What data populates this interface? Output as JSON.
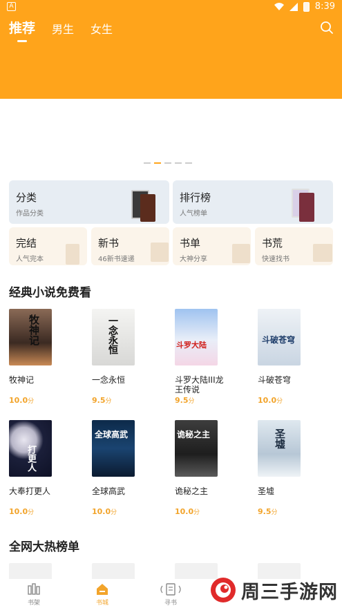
{
  "status": {
    "time": "8:39",
    "battery": "8"
  },
  "tabs": [
    {
      "label": "推荐"
    },
    {
      "label": "男生"
    },
    {
      "label": "女生"
    }
  ],
  "categories": {
    "big": [
      {
        "title": "分类",
        "sub": "作品分类"
      },
      {
        "title": "排行榜",
        "sub": "人气榜单"
      }
    ],
    "small": [
      {
        "title": "完结",
        "sub": "人气完本"
      },
      {
        "title": "新书",
        "sub": "46新书速递"
      },
      {
        "title": "书单",
        "sub": "大神分享"
      },
      {
        "title": "书荒",
        "sub": "快速找书"
      }
    ]
  },
  "sections": {
    "classic": "经典小说免费看",
    "hot": "全网大热榜单"
  },
  "books": [
    {
      "name": "牧神记",
      "score": "10.0",
      "unit": "分",
      "cover": "牧神记"
    },
    {
      "name": "一念永恒",
      "score": "9.5",
      "unit": "分",
      "cover": "一念永恒"
    },
    {
      "name": "斗罗大陆III龙王传说",
      "score": "9.5",
      "unit": "分",
      "cover": "斗罗大陆"
    },
    {
      "name": "斗破苍穹",
      "score": "10.0",
      "unit": "分",
      "cover": "斗破苍穹"
    },
    {
      "name": "大奉打更人",
      "score": "10.0",
      "unit": "分",
      "cover": "打更人"
    },
    {
      "name": "全球高武",
      "score": "10.0",
      "unit": "分",
      "cover": "全球高武"
    },
    {
      "name": "诡秘之主",
      "score": "10.0",
      "unit": "分",
      "cover": "诡秘之主"
    },
    {
      "name": "圣墟",
      "score": "9.5",
      "unit": "分",
      "cover": "圣墟"
    }
  ],
  "nav": [
    {
      "label": "书架",
      "icon": "bookshelf-icon"
    },
    {
      "label": "书城",
      "icon": "bookstore-icon"
    },
    {
      "label": "寻书",
      "icon": "find-book-icon"
    }
  ],
  "watermark": {
    "text": "周三手游网"
  },
  "colors": {
    "accent": "#FFA41B",
    "score": "#F2A42B"
  }
}
